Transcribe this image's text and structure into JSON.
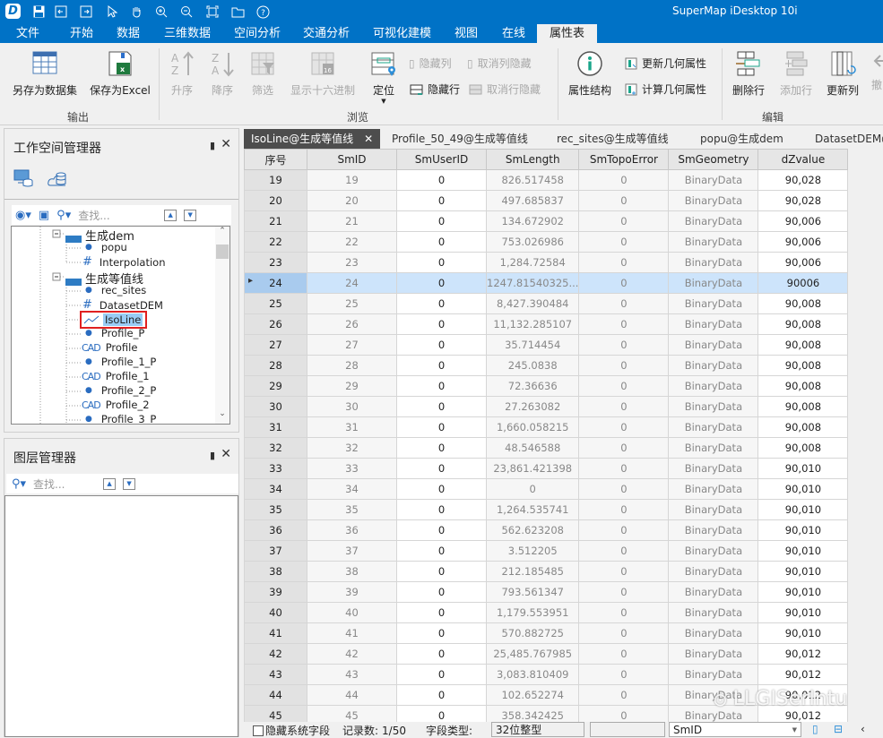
{
  "app": {
    "title": "SuperMap iDesktop 10i"
  },
  "quick_access": [
    "app-logo-icon",
    "save-icon",
    "back-icon",
    "forward-icon",
    "select-icon",
    "pan-icon",
    "zoom-in-icon",
    "zoom-out-icon",
    "full-extent-icon",
    "open-folder-icon",
    "help-icon"
  ],
  "menu": {
    "items": [
      "文件",
      "开始",
      "数据",
      "三维数据",
      "空间分析",
      "交通分析",
      "可视化建模",
      "视图",
      "在线",
      "属性表"
    ],
    "active": "属性表"
  },
  "ribbon": {
    "output": {
      "group_label": "输出",
      "save_as_dataset": "另存为数据集",
      "save_as_excel": "保存为Excel"
    },
    "browse": {
      "group_label": "浏览",
      "ascending": "升序",
      "descending": "降序",
      "filter": "筛选",
      "show_hex": "显示十六进制",
      "locate": "定位",
      "hide_column": "隐藏列",
      "unhide_column": "取消列隐藏",
      "hide_row": "隐藏行",
      "unhide_row": "取消行隐藏"
    },
    "edit": {
      "group_label": "编辑",
      "attribute_structure": "属性结构",
      "update_geometry": "更新几何属性",
      "compute_geometry": "计算几何属性",
      "delete_row": "删除行",
      "add_row": "添加行",
      "update_column": "更新列",
      "undo_partial": "撤"
    }
  },
  "workspace_manager": {
    "title": "工作空间管理器",
    "search_placeholder": "查找...",
    "tree": [
      {
        "label": "生成dem",
        "type": "datasource"
      },
      {
        "label": "popu",
        "type": "point"
      },
      {
        "label": "Interpolation",
        "type": "grid"
      },
      {
        "label": "生成等值线",
        "type": "datasource"
      },
      {
        "label": "rec_sites",
        "type": "point"
      },
      {
        "label": "DatasetDEM",
        "type": "grid"
      },
      {
        "label": "IsoLine",
        "type": "line",
        "selected": true
      },
      {
        "label": "Profile_P",
        "type": "point"
      },
      {
        "label": "Profile",
        "type": "cad"
      },
      {
        "label": "Profile_1_P",
        "type": "point"
      },
      {
        "label": "Profile_1",
        "type": "cad"
      },
      {
        "label": "Profile_2_P",
        "type": "point"
      },
      {
        "label": "Profile_2",
        "type": "cad"
      },
      {
        "label": "Profile_3_P",
        "type": "point"
      }
    ]
  },
  "layer_manager": {
    "title": "图层管理器",
    "search_placeholder": "查找..."
  },
  "doc_tabs": [
    {
      "label": "IsoLine@生成等值线",
      "active": true
    },
    {
      "label": "Profile_50_49@生成等值线"
    },
    {
      "label": "rec_sites@生成等值线"
    },
    {
      "label": "popu@生成dem"
    },
    {
      "label": "DatasetDEM@生"
    }
  ],
  "table": {
    "columns": [
      "序号",
      "SmID",
      "SmUserID",
      "SmLength",
      "SmTopoError",
      "SmGeometry",
      "dZvalue"
    ],
    "selected_row": "24",
    "rows": [
      [
        "19",
        "19",
        "0",
        "826.517458",
        "0",
        "BinaryData",
        "90,028"
      ],
      [
        "20",
        "20",
        "0",
        "497.685837",
        "0",
        "BinaryData",
        "90,028"
      ],
      [
        "21",
        "21",
        "0",
        "134.672902",
        "0",
        "BinaryData",
        "90,006"
      ],
      [
        "22",
        "22",
        "0",
        "753.026986",
        "0",
        "BinaryData",
        "90,006"
      ],
      [
        "23",
        "23",
        "0",
        "1,284.72584",
        "0",
        "BinaryData",
        "90,006"
      ],
      [
        "24",
        "24",
        "0",
        "1247.81540325...",
        "0",
        "BinaryData",
        "90006"
      ],
      [
        "25",
        "25",
        "0",
        "8,427.390484",
        "0",
        "BinaryData",
        "90,008"
      ],
      [
        "26",
        "26",
        "0",
        "11,132.285107",
        "0",
        "BinaryData",
        "90,008"
      ],
      [
        "27",
        "27",
        "0",
        "35.714454",
        "0",
        "BinaryData",
        "90,008"
      ],
      [
        "28",
        "28",
        "0",
        "245.0838",
        "0",
        "BinaryData",
        "90,008"
      ],
      [
        "29",
        "29",
        "0",
        "72.36636",
        "0",
        "BinaryData",
        "90,008"
      ],
      [
        "30",
        "30",
        "0",
        "27.263082",
        "0",
        "BinaryData",
        "90,008"
      ],
      [
        "31",
        "31",
        "0",
        "1,660.058215",
        "0",
        "BinaryData",
        "90,008"
      ],
      [
        "32",
        "32",
        "0",
        "48.546588",
        "0",
        "BinaryData",
        "90,008"
      ],
      [
        "33",
        "33",
        "0",
        "23,861.421398",
        "0",
        "BinaryData",
        "90,010"
      ],
      [
        "34",
        "34",
        "0",
        "0",
        "0",
        "BinaryData",
        "90,010"
      ],
      [
        "35",
        "35",
        "0",
        "1,264.535741",
        "0",
        "BinaryData",
        "90,010"
      ],
      [
        "36",
        "36",
        "0",
        "562.623208",
        "0",
        "BinaryData",
        "90,010"
      ],
      [
        "37",
        "37",
        "0",
        "3.512205",
        "0",
        "BinaryData",
        "90,010"
      ],
      [
        "38",
        "38",
        "0",
        "212.185485",
        "0",
        "BinaryData",
        "90,010"
      ],
      [
        "39",
        "39",
        "0",
        "793.561347",
        "0",
        "BinaryData",
        "90,010"
      ],
      [
        "40",
        "40",
        "0",
        "1,179.553951",
        "0",
        "BinaryData",
        "90,010"
      ],
      [
        "41",
        "41",
        "0",
        "570.882725",
        "0",
        "BinaryData",
        "90,010"
      ],
      [
        "42",
        "42",
        "0",
        "25,485.767985",
        "0",
        "BinaryData",
        "90,012"
      ],
      [
        "43",
        "43",
        "0",
        "3,083.810409",
        "0",
        "BinaryData",
        "90,012"
      ],
      [
        "44",
        "44",
        "0",
        "102.652274",
        "0",
        "BinaryData",
        "90,012"
      ],
      [
        "45",
        "45",
        "0",
        "358.342425",
        "0",
        "BinaryData",
        "90,012"
      ]
    ]
  },
  "status": {
    "hide_system_fields": "隐藏系统字段",
    "record_count_label": "记录数:",
    "record_count": "1/50",
    "field_type_label": "字段类型:",
    "field_type": "32位整型",
    "field_select": "SmID"
  },
  "watermark": "LLGISerIntu",
  "colors": {
    "accent": "#0072c6",
    "selected_row": "#cde4fb",
    "highlight_box": "#e02020"
  }
}
